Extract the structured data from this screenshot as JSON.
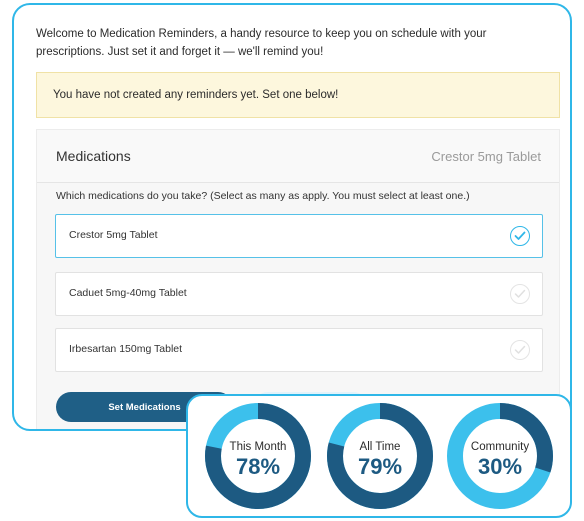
{
  "intro_text": "Welcome to Medication Reminders, a handy resource to keep you on schedule with your prescriptions. Just set it and forget it — we'll remind you!",
  "alert_text": "You have not created any reminders yet. Set one below!",
  "medications_panel": {
    "title": "Medications",
    "selected_summary": "Crestor 5mg Tablet",
    "question": "Which medications do you take? (Select as many as apply. You must select at least one.)",
    "items": [
      {
        "label": "Crestor 5mg Tablet",
        "checked": true
      },
      {
        "label": "Caduet 5mg-40mg Tablet",
        "checked": false
      },
      {
        "label": "Irbesartan 150mg Tablet",
        "checked": false
      }
    ],
    "set_button_label": "Set Medications"
  },
  "stats": [
    {
      "label": "This Month",
      "value": "78%",
      "fraction": 0.78
    },
    {
      "label": "All Time",
      "value": "79%",
      "fraction": 0.79
    },
    {
      "label": "Community",
      "value": "30%",
      "fraction": 0.3
    }
  ],
  "colors": {
    "accent": "#2fb7e8",
    "primary": "#1f5f86",
    "ring_progress": "#1d5a82",
    "ring_track": "#3cc0ec",
    "alert_bg": "#fdf7dd"
  }
}
